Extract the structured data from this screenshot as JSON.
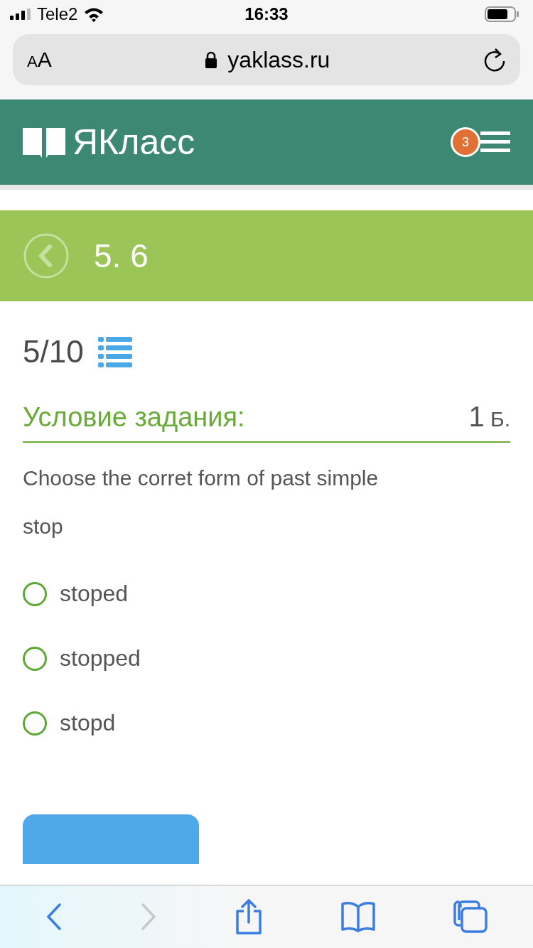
{
  "status_bar": {
    "carrier": "Tele2",
    "time": "16:33"
  },
  "address_bar": {
    "text_size_letters": [
      "A",
      "A"
    ],
    "url": "yaklass.ru"
  },
  "header": {
    "logo": "ЯКласс",
    "menu_badge": "3"
  },
  "lesson_bar": {
    "title": "5. 6"
  },
  "progress": "5/10",
  "condition": {
    "title": "Условие задания:",
    "points": "1",
    "points_unit": "Б."
  },
  "question": [
    "Choose the corret form of past simple",
    "stop"
  ],
  "options": [
    {
      "label": "stoped",
      "selected": false
    },
    {
      "label": "stopped",
      "selected": false
    },
    {
      "label": "stopd",
      "selected": false
    }
  ],
  "toolbar": {
    "back_disabled": false,
    "forward_disabled": true
  }
}
